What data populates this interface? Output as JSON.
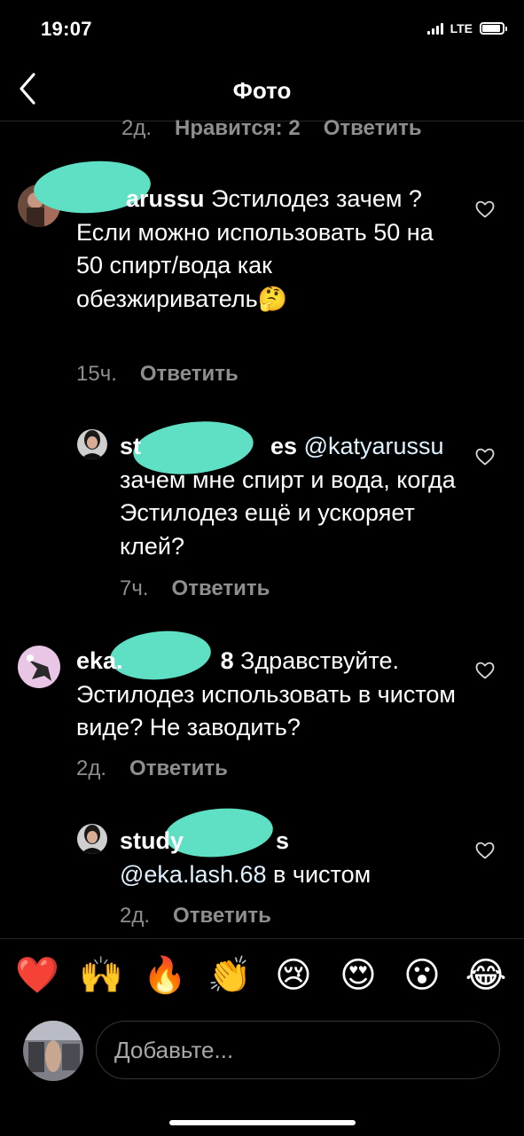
{
  "status_bar": {
    "time": "19:07",
    "network": "LTE"
  },
  "header": {
    "title": "Фото"
  },
  "previous_meta": {
    "time": "2д.",
    "likes": "Нравится: 2",
    "reply": "Ответить"
  },
  "comments": [
    {
      "username": "katyarussu",
      "visible_username": "arussu",
      "text": "Эстилодез зачем ? Если можно использовать 50 на 50 спирт/вода как обезжириватель🤔",
      "time": "15ч.",
      "reply": "Ответить"
    },
    {
      "username": "studylashes",
      "visible_username_start": "st",
      "visible_username_end": "es",
      "mention": "@katyarussu",
      "text": "зачем мне спирт и вода, когда Эстилодез ещё и ускоряет клей?",
      "time": "7ч.",
      "reply": "Ответить"
    },
    {
      "username": "eka.lash.68",
      "visible_username_start": "eka.",
      "visible_username_end": "8",
      "text": "Здравствуйте. Эстилодез использовать в чистом виде? Не заводить?",
      "time": "2д.",
      "reply": "Ответить"
    },
    {
      "username": "studylashes",
      "visible_username_start": "study",
      "visible_username_end": "s",
      "mention": "@eka.lash.68",
      "text": "в чистом",
      "time": "2д.",
      "reply": "Ответить"
    }
  ],
  "reactions": [
    "❤️",
    "🙌",
    "🔥",
    "👏",
    "😢",
    "😍",
    "😮",
    "😂"
  ],
  "composer": {
    "placeholder": "Добавьте..."
  },
  "colors": {
    "background": "#000000",
    "secondary_text": "#8e8e8e",
    "redaction": "#5fe0c4"
  }
}
